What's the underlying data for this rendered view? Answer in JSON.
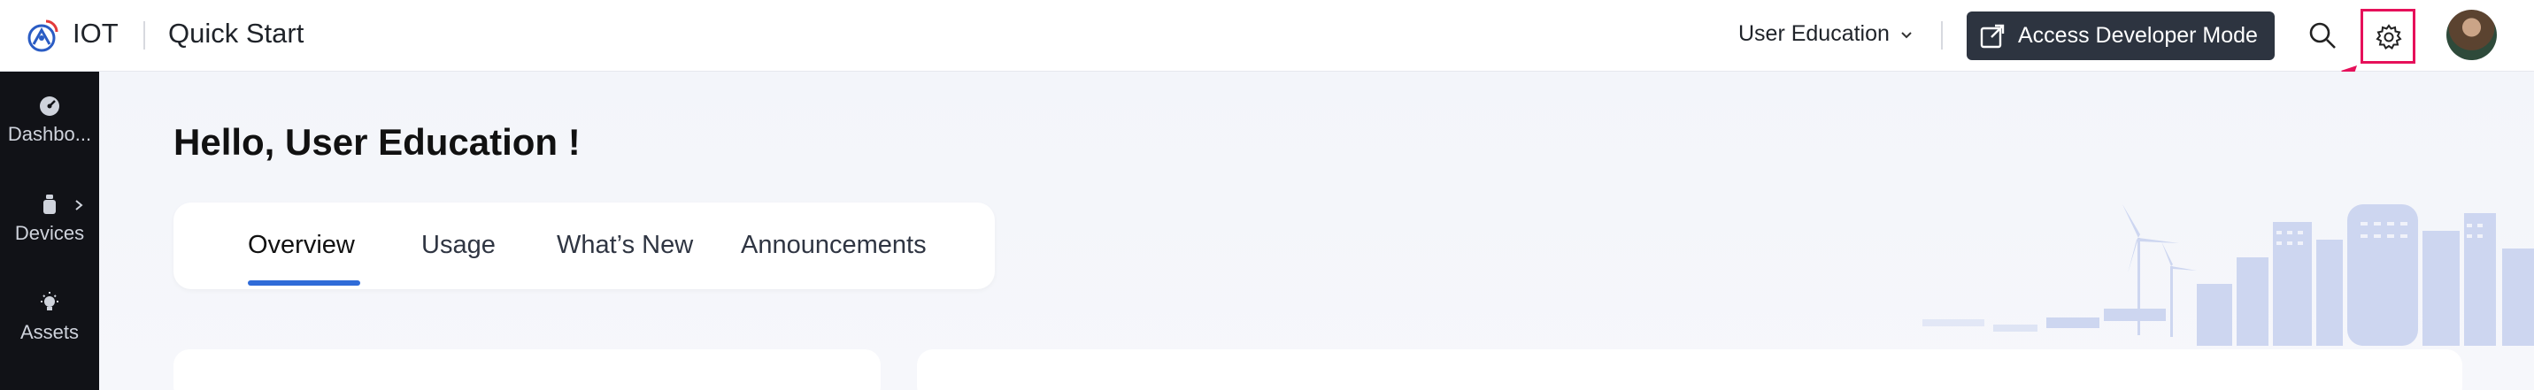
{
  "header": {
    "app_name": "IOT",
    "page_name": "Quick Start",
    "user_menu_label": "User Education",
    "developer_button_label": "Access Developer Mode"
  },
  "sidebar": {
    "items": [
      {
        "label": "Dashbo...",
        "icon": "gauge-icon"
      },
      {
        "label": "Devices",
        "icon": "device-icon"
      },
      {
        "label": "Assets",
        "icon": "bulb-icon"
      }
    ]
  },
  "main": {
    "greeting": "Hello, User Education !",
    "tabs": [
      {
        "label": "Overview",
        "active": true
      },
      {
        "label": "Usage",
        "active": false
      },
      {
        "label": "What’s New",
        "active": false
      },
      {
        "label": "Announcements",
        "active": false
      }
    ]
  },
  "colors": {
    "accent": "#2f6bd8",
    "dark_button": "#2d3440",
    "highlight": "#e6105a",
    "sidebar_bg": "#111217"
  }
}
